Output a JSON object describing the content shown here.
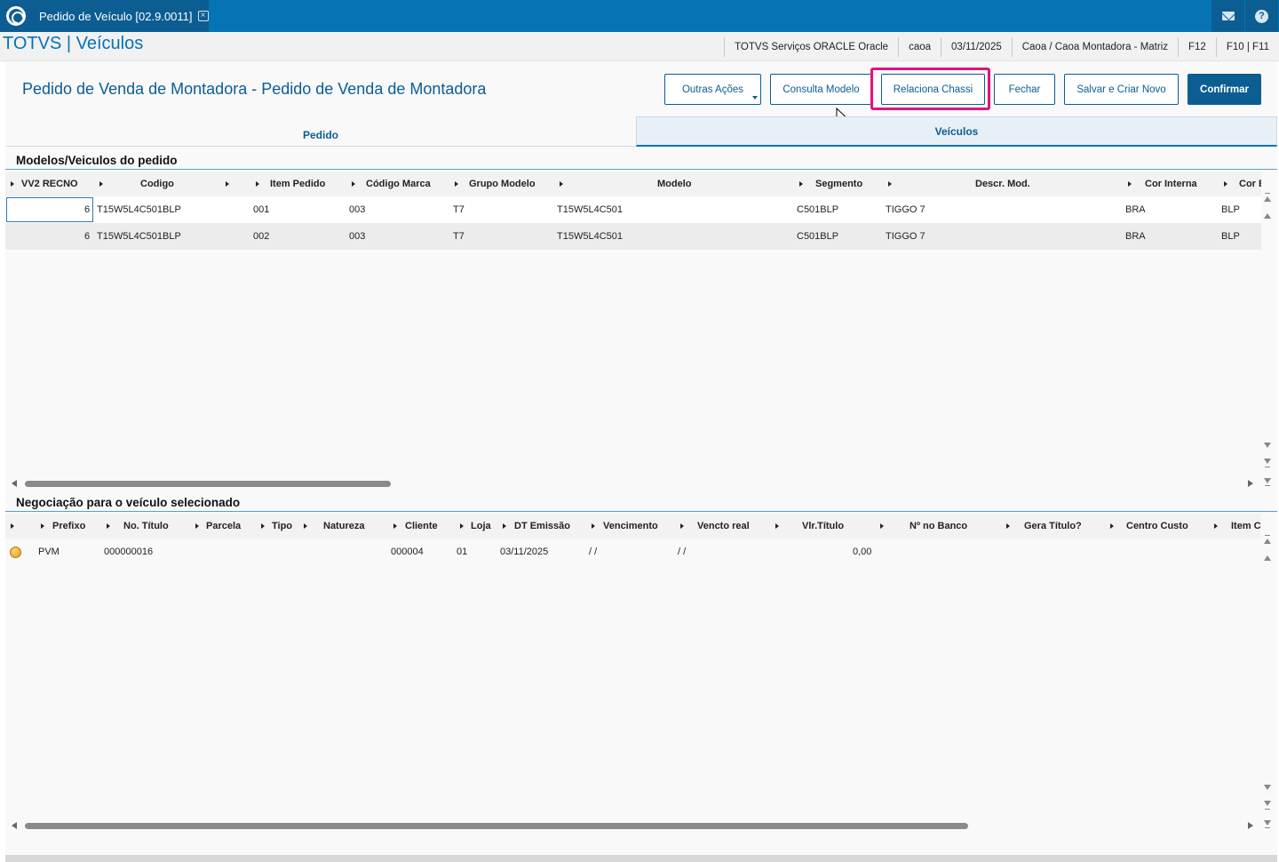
{
  "window": {
    "tab_title": "Pedido de Veículo [02.9.0011]",
    "close_glyph": "×",
    "help_glyph": "?"
  },
  "header": {
    "brand": "TOTVS | Veículos",
    "status": [
      "TOTVS Serviços ORACLE Oracle",
      "caoa",
      "03/11/2025",
      "Caoa / Caoa Montadora - Matriz",
      "F12",
      "F10 | F11"
    ]
  },
  "form": {
    "title": "Pedido de Venda de Montadora - Pedido de Venda de Montadora",
    "buttons": {
      "outras": "Outras Ações",
      "consulta": "Consulta Modelo",
      "relaciona": "Relaciona Chassi",
      "fechar": "Fechar",
      "salvar": "Salvar e Criar Novo",
      "confirmar": "Confirmar"
    },
    "tabs": [
      "Pedido",
      "Veículos"
    ]
  },
  "modelos": {
    "title": "Modelos/Veiculos do pedido",
    "columns": [
      "VV2 RECNO",
      "Codigo",
      "Item Pedido",
      "Código Marca",
      "Grupo Modelo",
      "Modelo",
      "Segmento",
      "Descr. Mod.",
      "Cor Interna",
      "Cor E"
    ],
    "rows": [
      [
        "6",
        "T15W5L4C501BLP",
        "001",
        "003",
        "T7",
        "T15W5L4C501",
        "C501BLP",
        "TIGGO 7",
        "BRA",
        "BLP"
      ],
      [
        "6",
        "T15W5L4C501BLP",
        "002",
        "003",
        "T7",
        "T15W5L4C501",
        "C501BLP",
        "TIGGO 7",
        "BRA",
        "BLP"
      ]
    ]
  },
  "negociacao": {
    "title": "Negociação para o veículo selecionado",
    "columns": [
      "Prefixo",
      "No. Título",
      "Parcela",
      "Tipo",
      "Natureza",
      "Cliente",
      "Loja",
      "DT Emissão",
      "Vencimento",
      "Vencto real",
      "Vlr.Título",
      "Nº no Banco",
      "Gera Título?",
      "Centro Custo",
      "Item C"
    ],
    "rows": [
      [
        "PVM",
        "000000016",
        "",
        "",
        "",
        "000004",
        "01",
        "03/11/2025",
        "/ /",
        "/ /",
        "0,00",
        "",
        "",
        "",
        ""
      ]
    ]
  },
  "colors": {
    "brand_blue": "#0673b4",
    "dark_blue": "#0b5d92",
    "highlight": "#e0137d"
  }
}
